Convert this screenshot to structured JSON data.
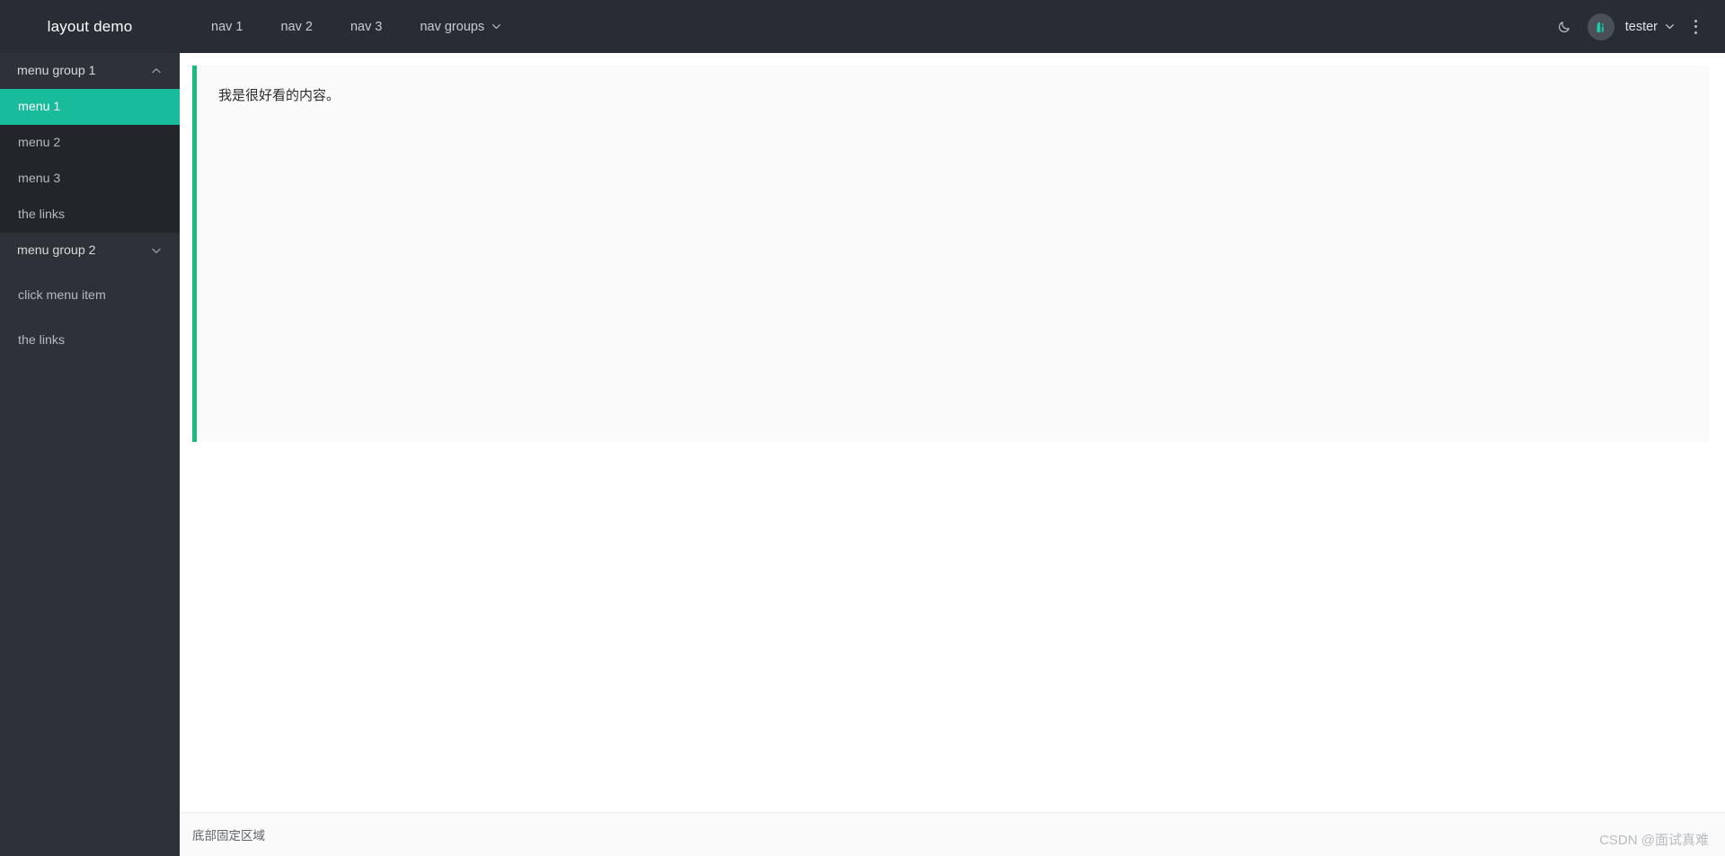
{
  "header": {
    "logo_text": "layout demo",
    "nav_items": [
      {
        "label": "nav 1",
        "has_dropdown": false
      },
      {
        "label": "nav 2",
        "has_dropdown": false
      },
      {
        "label": "nav 3",
        "has_dropdown": false
      },
      {
        "label": "nav groups",
        "has_dropdown": true
      }
    ],
    "dark_mode_icon": "moon-icon",
    "avatar_icon": "avatar-logo-icon",
    "username": "tester",
    "user_chevron_icon": "chevron-down-icon",
    "more_icon": "more-vertical-icon"
  },
  "sidebar": {
    "groups": [
      {
        "label": "menu group 1",
        "expanded": true,
        "chevron_icon": "chevron-up-icon",
        "items": [
          {
            "label": "menu 1",
            "active": true
          },
          {
            "label": "menu 2",
            "active": false
          },
          {
            "label": "menu 3",
            "active": false
          },
          {
            "label": "the links",
            "active": false
          }
        ]
      },
      {
        "label": "menu group 2",
        "expanded": false,
        "chevron_icon": "chevron-down-icon",
        "items": []
      }
    ],
    "standalone_items": [
      {
        "label": "click menu item"
      },
      {
        "label": "the links"
      }
    ]
  },
  "content": {
    "text": "我是很好看的内容。",
    "accent_color": "#1bbc7c",
    "background_color": "#fafafa"
  },
  "footer": {
    "text": "底部固定区域"
  },
  "watermark": {
    "text": "CSDN @面试真难"
  },
  "colors": {
    "topbar_bg": "#282c34",
    "sidebar_bg": "#2e3238",
    "submenu_bg": "#22262a",
    "active_menu_bg": "#18bc9c",
    "content_accent": "#1bbc7c"
  }
}
